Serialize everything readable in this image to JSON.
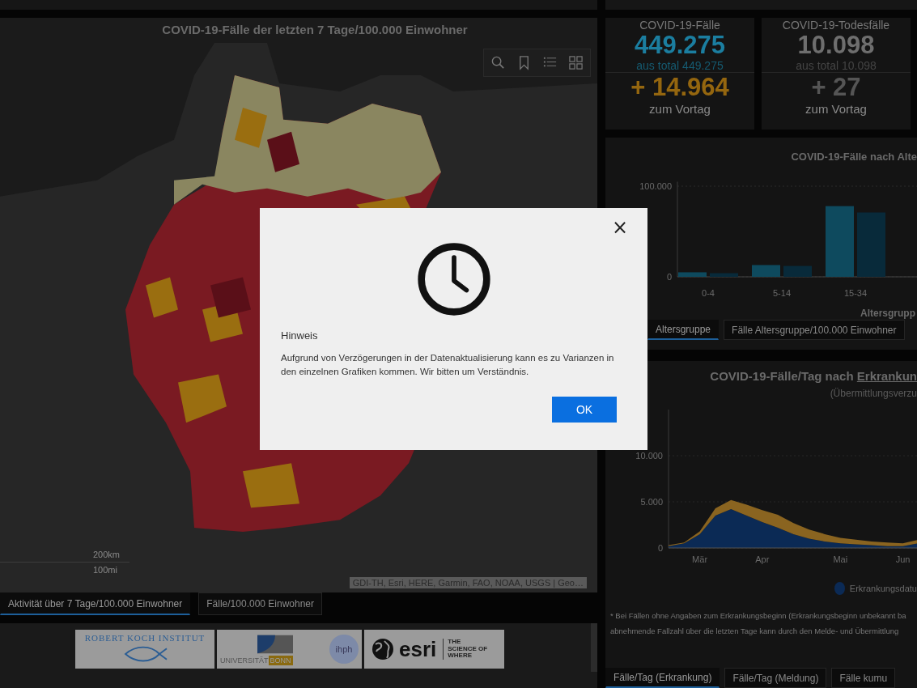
{
  "map_panel": {
    "title": "COVID-19-Fälle der letzten 7 Tage/100.000 Einwohner",
    "scale": [
      "200km",
      "100mi"
    ],
    "attribution": "GDI-TH, Esri, HERE, Garmin, FAO, NOAA, USGS | Geo…"
  },
  "map_tabs": [
    {
      "label": "Aktivität über 7 Tage/100.000 Einwohner",
      "selected": true
    },
    {
      "label": "Fälle/100.000 Einwohner",
      "selected": false
    }
  ],
  "logos": {
    "rki": "ROBERT KOCH INSTITUT",
    "bonn": "UNIVERSITÄT",
    "bonn_city": "BONN",
    "ihph": "ihph",
    "esri": "esri",
    "esri_tagline": "THE SCIENCE OF WHERE"
  },
  "stats": [
    {
      "kind": "cases",
      "title": "COVID-19-Fälle",
      "value": "449.275",
      "total": "aus total 449.275",
      "change": "+ 14.964",
      "change_note": "zum Vortag"
    },
    {
      "kind": "deaths",
      "title": "COVID-19-Todesfälle",
      "value": "10.098",
      "total": "aus total 10.098",
      "change": "+ 27",
      "change_note": "zum Vortag"
    }
  ],
  "age_panel": {
    "chart_data": {
      "type": "bar",
      "title": "COVID-19-Fälle nach Alte",
      "xlabel": "Altersgrupp",
      "categories": [
        "0-4",
        "5-14",
        "15-34"
      ],
      "series": [
        {
          "color": "#0e4a5e",
          "values": [
            5000,
            13000,
            78000
          ]
        },
        {
          "color": "#082a3a",
          "values": [
            4000,
            12000,
            71000
          ]
        }
      ],
      "ylim": [
        0,
        105000
      ],
      "yticks": [
        0,
        {
          "value": 100000,
          "label": "100.000"
        }
      ]
    },
    "tabs": [
      {
        "label": "Altersgruppe",
        "selected": true
      },
      {
        "label": "Fälle Altersgruppe/100.000 Einwohner",
        "selected": false
      }
    ]
  },
  "epi_panel": {
    "title": "COVID-19-Fälle/Tag nach",
    "title_link": "Erkrankun",
    "subtitle": "(Übermittlungsverzu",
    "chart_data": {
      "type": "area",
      "stacked": true,
      "categories": [
        null,
        null,
        "Mär",
        null,
        null,
        null,
        "Apr",
        null,
        null,
        null,
        null,
        "Mai",
        null,
        null,
        null,
        "Jun",
        null,
        null
      ],
      "series": [
        {
          "name": "Erkrankungsdatu",
          "color": "#0b2a55",
          "values": [
            200,
            500,
            1500,
            3500,
            4200,
            3500,
            2800,
            2200,
            1500,
            1000,
            700,
            500,
            400,
            300,
            200,
            200,
            500,
            300
          ]
        },
        {
          "color": "#8a6420",
          "values": [
            100,
            100,
            300,
            800,
            1000,
            1200,
            1300,
            1400,
            1200,
            1000,
            800,
            600,
            500,
            400,
            400,
            300,
            400,
            300
          ]
        }
      ],
      "ylim": [
        0,
        15000
      ],
      "yticks": [
        0,
        {
          "value": 5000,
          "label": "5.000"
        },
        {
          "value": 10000,
          "label": "10.000"
        }
      ]
    },
    "notes": [
      "* Bei Fällen ohne Angaben zum Erkrankungsbeginn (Erkrankungsbeginn unbekannt ba",
      "abnehmende Fallzahl über die letzten Tage kann durch den Melde- und Übermittlung"
    ],
    "tabs": [
      {
        "label": "Fälle/Tag (Erkrankung)",
        "selected": true
      },
      {
        "label": "Fälle/Tag (Meldung)",
        "selected": false
      },
      {
        "label": "Fälle kumu",
        "selected": false
      }
    ]
  },
  "dialog": {
    "title": "Hinweis",
    "message": "Aufgrund von Verzögerungen in der Datenaktualisierung kann es zu Varianzen in den einzelnen Grafiken kommen. Wir bitten um Verständnis.",
    "close": "×",
    "button": "OK"
  }
}
